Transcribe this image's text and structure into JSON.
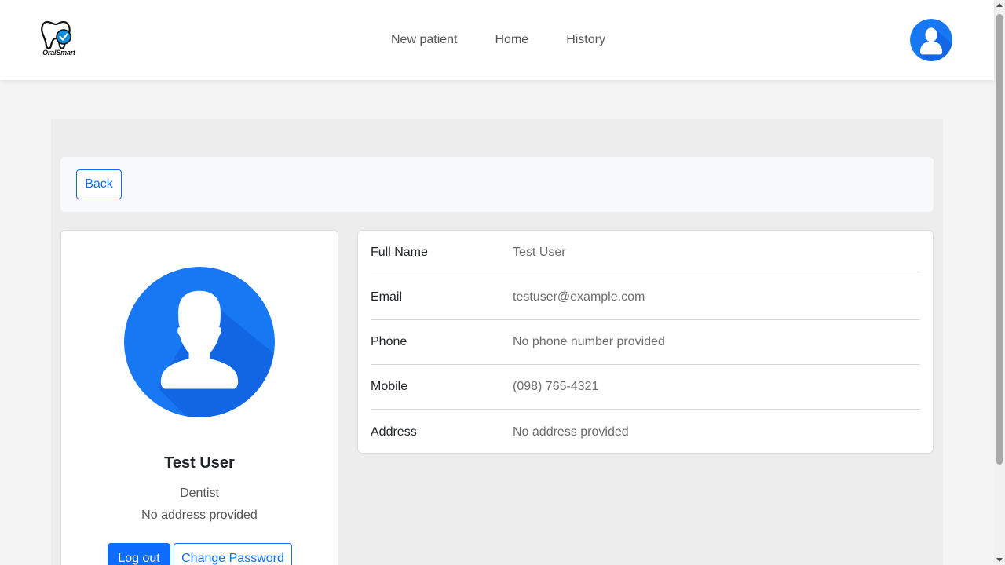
{
  "brand": {
    "name": "OralSmart"
  },
  "nav": {
    "links": [
      "New patient",
      "Home",
      "History"
    ]
  },
  "back_button": "Back",
  "profile": {
    "name": "Test User",
    "role": "Dentist",
    "address": "No address provided",
    "logout_label": "Log out",
    "change_password_label": "Change Password"
  },
  "details": [
    {
      "label": "Full Name",
      "value": "Test User"
    },
    {
      "label": "Email",
      "value": "testuser@example.com"
    },
    {
      "label": "Phone",
      "value": "No phone number provided"
    },
    {
      "label": "Mobile",
      "value": "(098) 765-4321"
    },
    {
      "label": "Address",
      "value": "No address provided"
    }
  ],
  "colors": {
    "primary": "#0d6efd",
    "avatar_bg": "#1877f2",
    "avatar_shadow": "#0f5bd8"
  },
  "icons": [
    "tooth-check-icon",
    "user-avatar-icon"
  ]
}
